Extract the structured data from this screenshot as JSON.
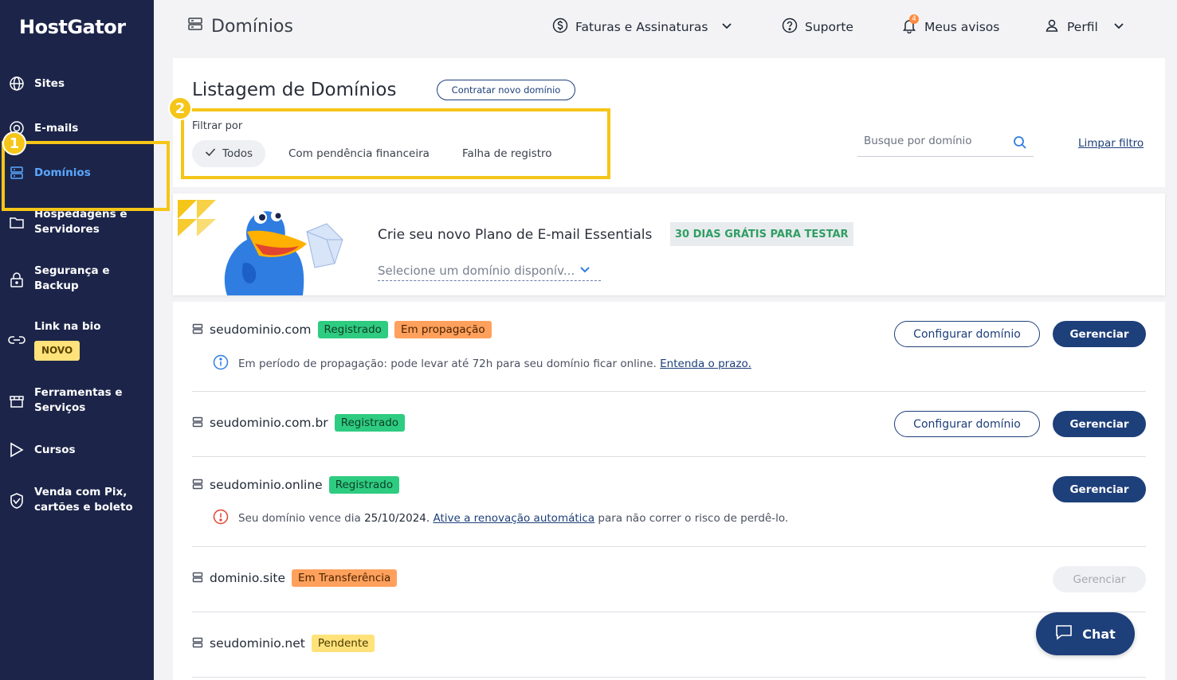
{
  "brand": {
    "logo": "HostGator"
  },
  "sidebar": {
    "items": [
      {
        "label": "Sites",
        "icon": "globe-icon"
      },
      {
        "label": "E-mails",
        "icon": "at-icon"
      },
      {
        "label": "Domínios",
        "icon": "server-icon",
        "active": true
      },
      {
        "label": "Hospedagens e Servidores",
        "icon": "folder-icon"
      },
      {
        "label": "Segurança e Backup",
        "icon": "lock-icon"
      },
      {
        "label": "Link na bio",
        "icon": "link-icon",
        "badge": "NOVO"
      },
      {
        "label": "Ferramentas e Serviços",
        "icon": "store-icon"
      },
      {
        "label": "Cursos",
        "icon": "play-icon"
      },
      {
        "label": "Venda com Pix, cartões e boleto",
        "icon": "shield-icon"
      }
    ]
  },
  "steps": {
    "one": "1",
    "two": "2"
  },
  "header": {
    "title": "Domínios",
    "invoices": "Faturas e Assinaturas",
    "support": "Suporte",
    "notices": "Meus avisos",
    "notices_count": "4",
    "profile": "Perfil"
  },
  "listing": {
    "title": "Listagem de Domínios",
    "new_domain_button": "Contratar novo domínio",
    "filter_label": "Filtrar por",
    "filters": [
      "Todos",
      "Com pendência financeira",
      "Falha de registro"
    ],
    "selected_filter": "Todos",
    "search_placeholder": "Busque por domínio",
    "clear_filter": "Limpar filtro"
  },
  "promo": {
    "title": "Crie seu novo Plano de E-mail Essentials",
    "tag": "30 DIAS GRÁTIS PARA TESTAR",
    "select_placeholder": "Selecione um domínio disponív..."
  },
  "domains": [
    {
      "name": "seudominio.com",
      "tags": [
        {
          "text": "Registrado",
          "color": "green"
        },
        {
          "text": "Em propagação",
          "color": "orange"
        }
      ],
      "config_button": "Configurar domínio",
      "manage_button": "Gerenciar",
      "note": {
        "type": "info",
        "text": "Em período de propagação: pode levar até 72h para seu domínio ficar online.",
        "link": "Entenda o prazo."
      }
    },
    {
      "name": "seudominio.com.br",
      "tags": [
        {
          "text": "Registrado",
          "color": "green"
        }
      ],
      "config_button": "Configurar domínio",
      "manage_button": "Gerenciar"
    },
    {
      "name": "seudominio.online",
      "tags": [
        {
          "text": "Registrado",
          "color": "green"
        }
      ],
      "manage_button": "Gerenciar",
      "note": {
        "type": "warning",
        "text_before": "Seu domínio vence dia",
        "date": "25/10/2024.",
        "link": "Ative a renovação automática",
        "text_after": "para não correr o risco de perdê-lo."
      }
    },
    {
      "name": "dominio.site",
      "tags": [
        {
          "text": "Em Transferência",
          "color": "orange"
        }
      ],
      "manage_button": "Gerenciar",
      "manage_disabled": true
    },
    {
      "name": "seudominio.net",
      "tags": [
        {
          "text": "Pendente",
          "color": "yellow"
        }
      ]
    }
  ],
  "chat": {
    "label": "Chat"
  },
  "colors": {
    "sidebar_bg": "#1c2549",
    "primary": "#1d3f7a",
    "highlight": "#f5c518",
    "active_link": "#5aa8ff"
  }
}
